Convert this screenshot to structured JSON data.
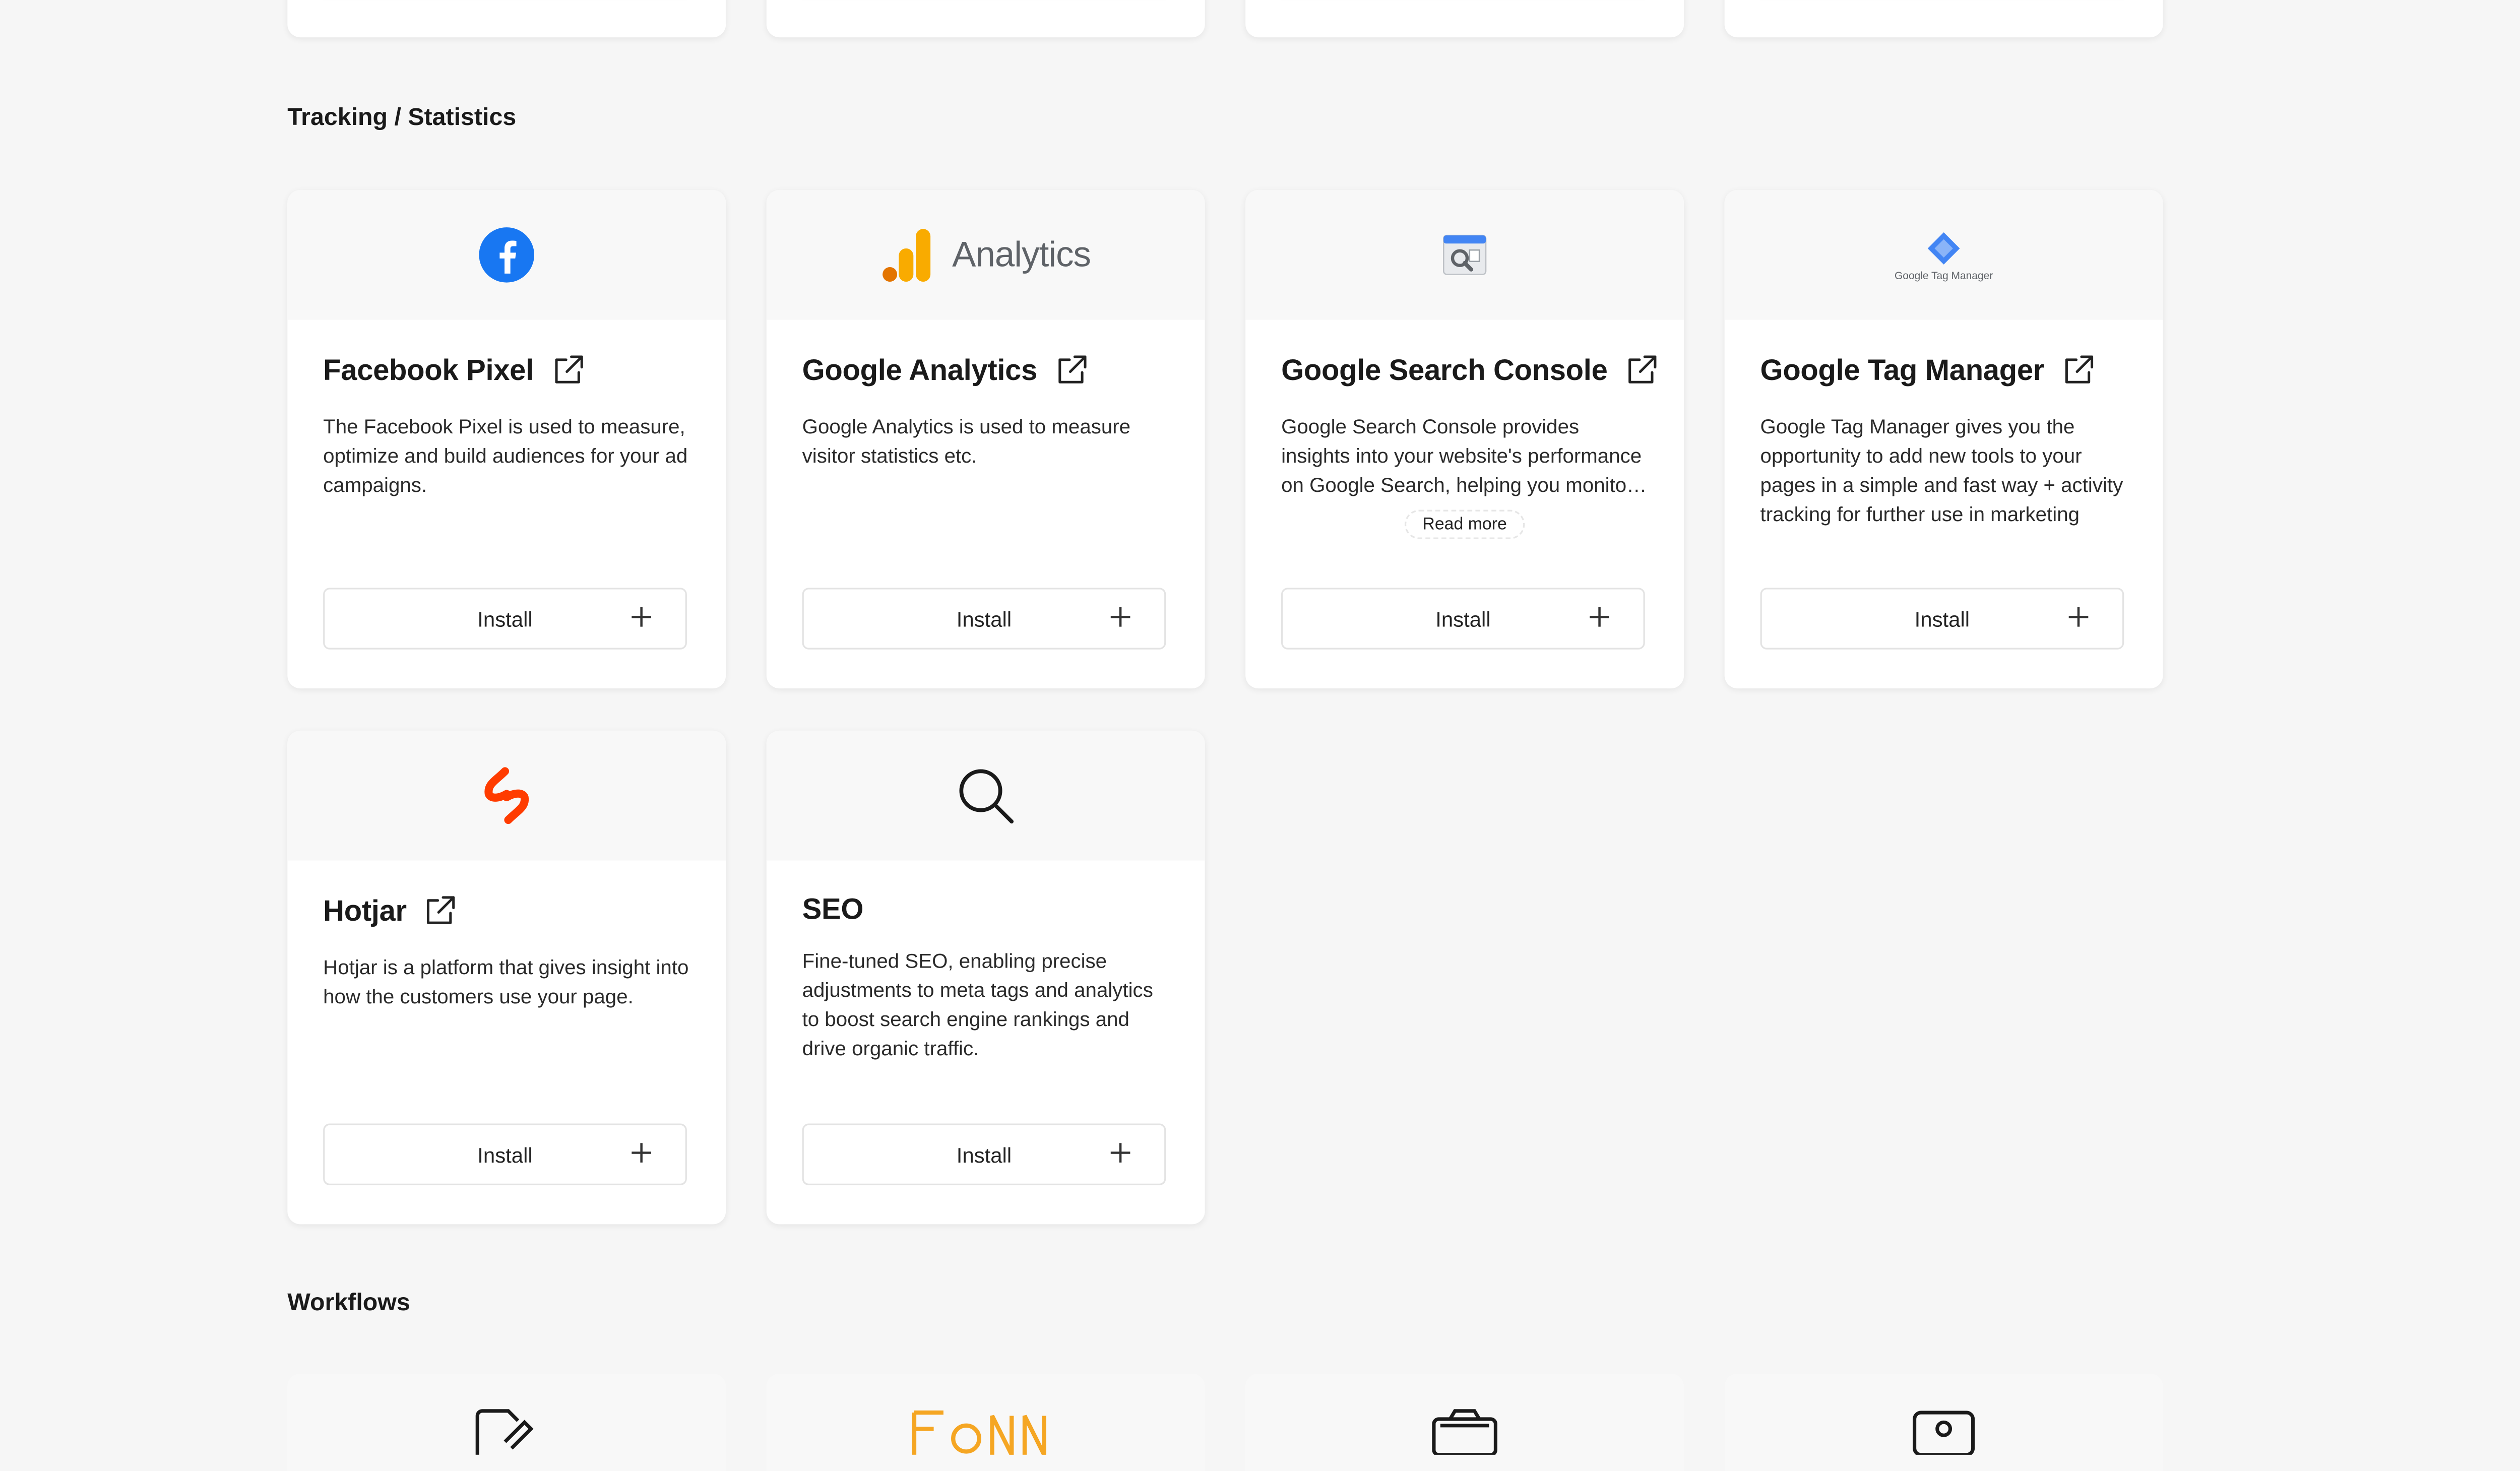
{
  "sections": {
    "tracking": "Tracking / Statistics",
    "workflows": "Workflows"
  },
  "analytics_logo_text": "Analytics",
  "tag_manager_logo_text": "Google Tag Manager",
  "install_label": "Install",
  "read_more_label": "Read more",
  "cards": [
    {
      "title": "Facebook Pixel",
      "description": "The Facebook Pixel is used to measure, optimize and build audiences for your ad campaigns."
    },
    {
      "title": "Google Analytics",
      "description": "Google Analytics is used to measure visitor statistics etc."
    },
    {
      "title": "Google Search Console",
      "description": "Google Search Console provides insights into your website's performance on Google Search, helping you monitor and improve visibility."
    },
    {
      "title": "Google Tag Manager",
      "description": "Google Tag Manager gives you the opportunity to add new tools to your pages in a simple and fast way + activity tracking for further use in marketing"
    },
    {
      "title": "Hotjar",
      "description": "Hotjar is a platform that gives insight into how the customers use your page."
    },
    {
      "title": "SEO",
      "description": "Fine-tuned SEO, enabling precise adjustments to meta tags and analytics to boost search engine rankings and drive organic traffic."
    }
  ],
  "colors": {
    "facebook": "#1877F2",
    "analytics_orange": "#F9AB00",
    "analytics_dark": "#E37400",
    "hotjar": "#FF3C00",
    "gtm_blue": "#4285F4"
  }
}
